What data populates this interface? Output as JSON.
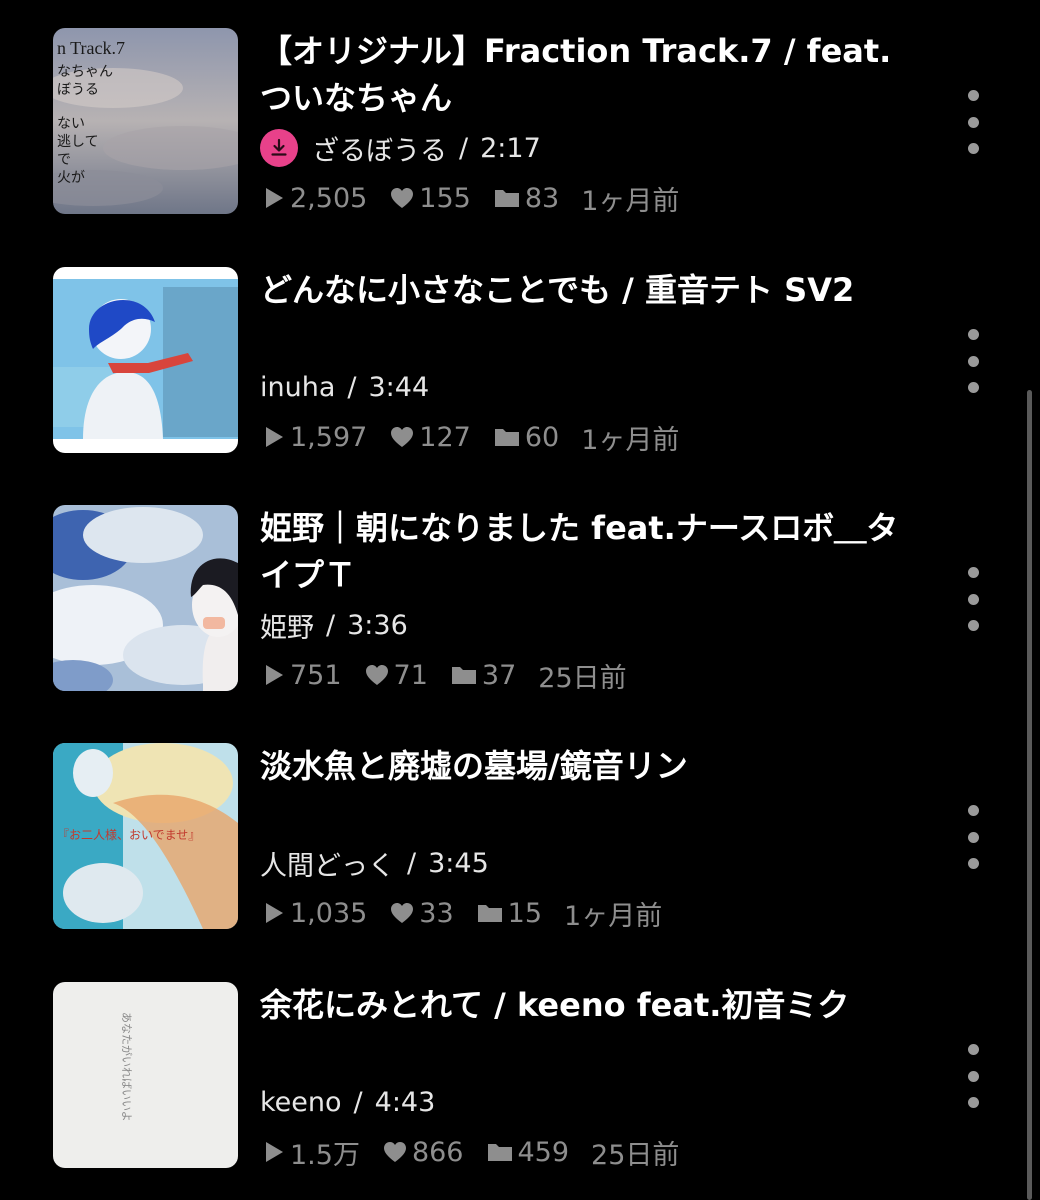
{
  "videos": [
    {
      "title": "【オリジナル】Fraction Track.7 / feat.ついなちゃん",
      "author": "ざるぼうる",
      "duration": "2:17",
      "views": "2,505",
      "likes": "155",
      "mylists": "83",
      "posted": "1ヶ月前",
      "downloaded": true,
      "thumb_text": [
        "n Track.7",
        "なちゃん",
        "ぼうる",
        "ない",
        "逃して",
        "で",
        "火が"
      ]
    },
    {
      "title": "どんなに小さなことでも / 重音テト SV2",
      "author": "inuha",
      "duration": "3:44",
      "views": "1,597",
      "likes": "127",
      "mylists": "60",
      "posted": "1ヶ月前"
    },
    {
      "title": "姫野｜朝になりました feat.ナースロボ＿タイプＴ",
      "author": "姫野",
      "duration": "3:36",
      "views": "751",
      "likes": "71",
      "mylists": "37",
      "posted": "25日前"
    },
    {
      "title": "淡水魚と廃墟の墓場/鏡音リン",
      "author": "人間どっく",
      "duration": "3:45",
      "views": "1,035",
      "likes": "33",
      "mylists": "15",
      "posted": "1ヶ月前",
      "thumb_text": "『お二人様、おいでませ』"
    },
    {
      "title": "余花にみとれて / keeno feat.初音ミク",
      "author": "keeno",
      "duration": "4:43",
      "views": "1.5万",
      "likes": "866",
      "mylists": "459",
      "posted": "25日前",
      "thumb_text": "あなたがいればいいよ"
    }
  ],
  "colors": {
    "background": "#000000",
    "title": "#ffffff",
    "meta": "#8e8e8e",
    "download_badge": "#e8418a"
  },
  "icons": [
    "play-icon",
    "heart-icon",
    "folder-icon",
    "download-icon",
    "more-icon"
  ]
}
